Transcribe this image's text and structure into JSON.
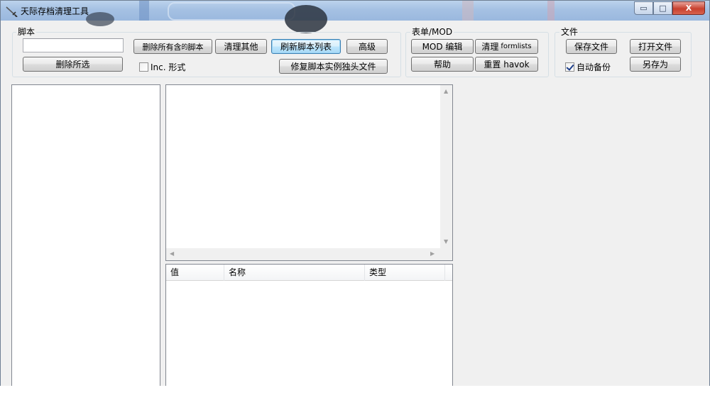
{
  "window": {
    "title": "天际存档清理工具",
    "controls": {
      "minimize": "▭",
      "maximize": "□",
      "close": "X"
    }
  },
  "script_group": {
    "label": "脚本",
    "search_value": "",
    "delete_selected": "删除所选",
    "delete_all_with": "删除所有含 ",
    "delete_all_glyph": "的",
    "delete_all_suffix": "脚本",
    "clean_other": "清理其他",
    "refresh_list": "刷新脚本列表",
    "advanced": "高级",
    "inc_forms": "Inc. 形式",
    "inc_forms_checked": false,
    "fix_orphans": "修复脚本实例独头文件"
  },
  "forms_group": {
    "label": "表单/MOD",
    "mod_edit": "MOD 编辑",
    "clean_formlists": "清理",
    "clean_formlists_suffix": "formlists",
    "help": "帮助",
    "reset_havok": "重置 havok"
  },
  "file_group": {
    "label": "文件",
    "save_file": "保存文件",
    "open_file": "打开文件",
    "auto_backup": "自动备份",
    "auto_backup_checked": true,
    "save_as": "另存为"
  },
  "list_view": {
    "columns": [
      "值",
      "名称",
      "类型"
    ]
  }
}
